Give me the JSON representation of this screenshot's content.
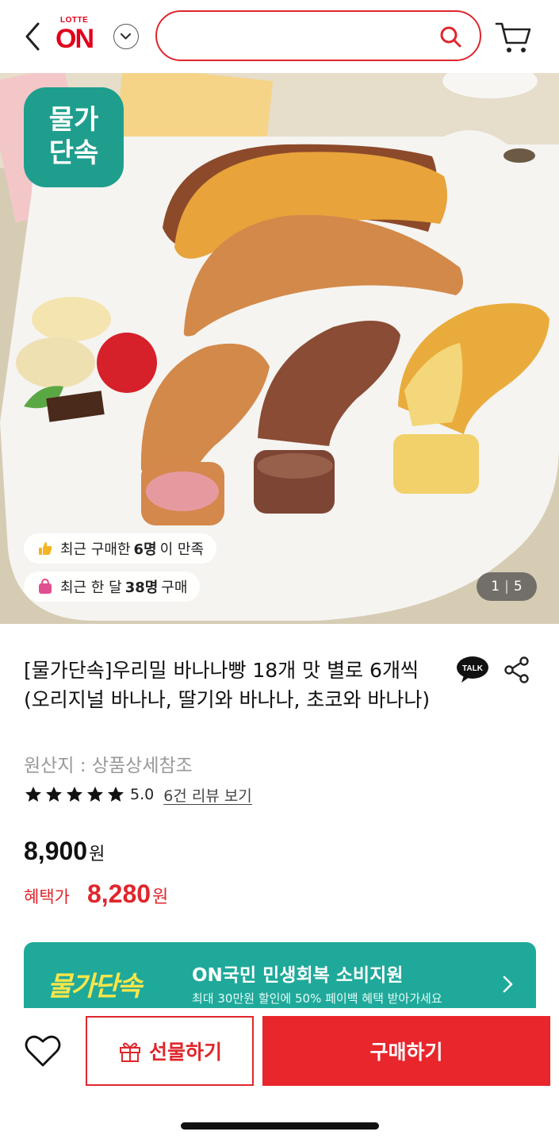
{
  "header": {
    "logo_small": "LOTTE",
    "logo_big": "ON",
    "search_placeholder": "",
    "search_value": ""
  },
  "product_image": {
    "badge_line1": "물가",
    "badge_line2": "단속",
    "pill1_prefix": "최근 구매한",
    "pill1_count": "6명",
    "pill1_suffix": "이 만족",
    "pill2_prefix": "최근 한 달",
    "pill2_count": "38명",
    "pill2_suffix": "구매",
    "page_current": "1",
    "page_separator": "|",
    "page_total": "5"
  },
  "product": {
    "title": "[물가단속]우리밀 바나나빵 18개 맛 별로 6개씩 (오리지널 바나나, 딸기와 바나나, 초코와 바나나)",
    "talk_label": "TALK",
    "origin": "원산지 : 상품상세참조",
    "rating_value": "5.0",
    "rating_stars": 5,
    "review_link": "6건 리뷰 보기",
    "price": "8,900",
    "price_unit": "원",
    "benefit_label": "혜택가",
    "benefit_price": "8,280",
    "benefit_unit": "원"
  },
  "promo": {
    "logo_text": "물가단속",
    "title": "ON국민 민생회복 소비지원",
    "subtitle": "최대 30만원 할인에 50% 페이백 혜택 받아가세요"
  },
  "bottom_bar": {
    "gift_label": "선물하기",
    "buy_label": "구매하기"
  },
  "colors": {
    "brand_red": "#e0262c",
    "promo_teal": "#1fa99a",
    "badge_teal": "#1f9e8e"
  }
}
